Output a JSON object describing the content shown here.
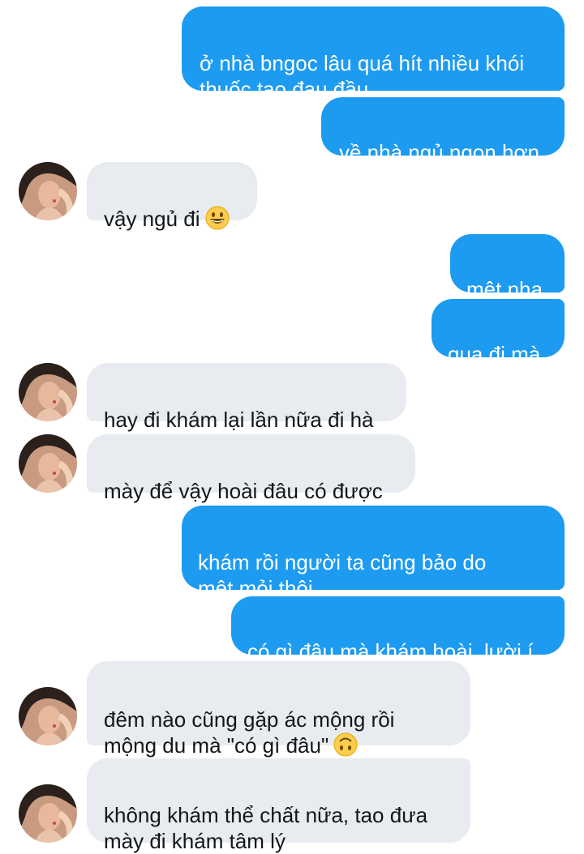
{
  "conversation": {
    "messages": [
      {
        "sender": "me",
        "text": "ở nhà bngoc lâu quá hít nhiều khói\nthuốc tao đau đầu"
      },
      {
        "sender": "me",
        "text": "về nhà ngủ ngon hơn"
      },
      {
        "sender": "them",
        "text": "vậy ngủ đi",
        "emoji": "grinning-face"
      },
      {
        "sender": "me",
        "text": "mệt nha"
      },
      {
        "sender": "me",
        "text": "qua đi mà"
      },
      {
        "sender": "them",
        "text": "hay đi khám lại lần nữa đi hà"
      },
      {
        "sender": "them",
        "text": "mày để vậy hoài đâu có được"
      },
      {
        "sender": "me",
        "text": "khám rồi người ta cũng bảo do\nmệt mỏi thôi"
      },
      {
        "sender": "me",
        "text": "có gì đâu mà khám hoài, lười í"
      },
      {
        "sender": "them",
        "text": "đêm nào cũng gặp ác mộng rồi\nmộng du mà \"có gì đâu\"",
        "emoji": "upside-down-face"
      },
      {
        "sender": "them",
        "text": "không khám thể chất nữa, tao đưa\nmày đi khám tâm lý"
      }
    ]
  },
  "colors": {
    "sent_bubble": "#1d9bf0",
    "received_bubble": "#e8ebef",
    "emoji_yellow": "#ffcc4d"
  }
}
